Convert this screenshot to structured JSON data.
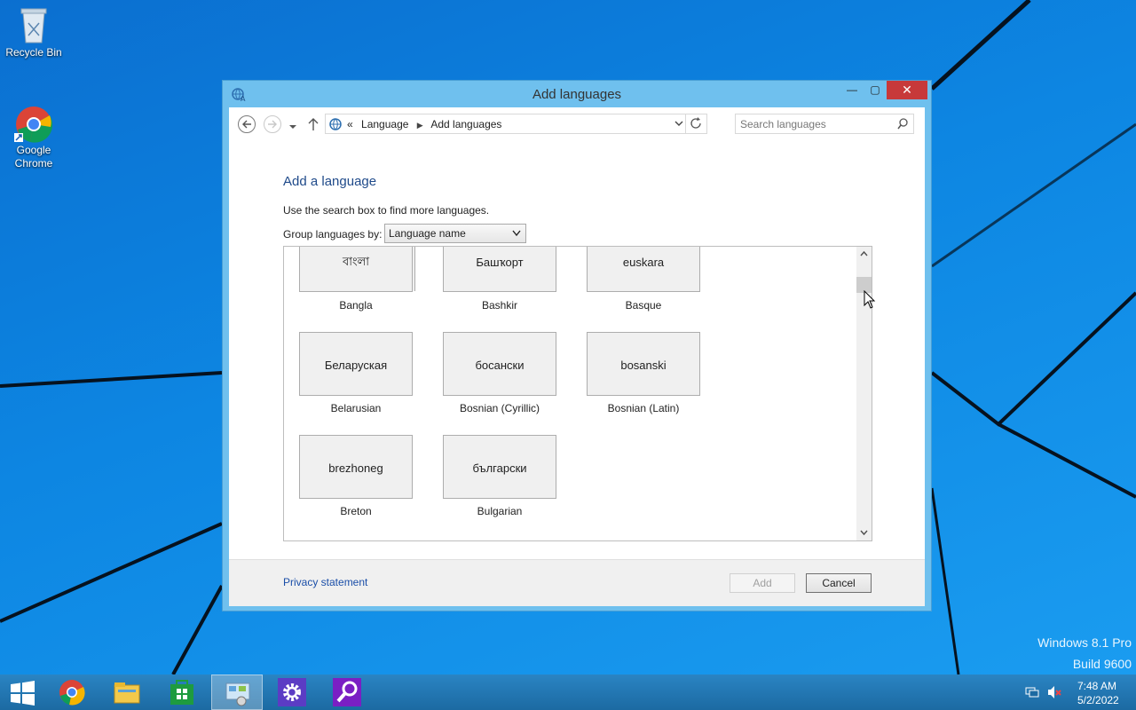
{
  "desktop": {
    "icons": [
      {
        "label": "Recycle Bin"
      },
      {
        "label": "Google Chrome"
      }
    ],
    "watermark_line1": "Windows 8.1 Pro",
    "watermark_line2": "Build 9600"
  },
  "window": {
    "title": "Add languages",
    "controls": {
      "minimize": "—",
      "maximize": "▢",
      "close": "✕"
    }
  },
  "address_bar": {
    "overflow": "«",
    "breadcrumbs": [
      "Language",
      "Add languages"
    ],
    "separator": "▶"
  },
  "search": {
    "placeholder": "Search languages"
  },
  "content": {
    "heading": "Add a language",
    "hint": "Use the search box to find more languages.",
    "group_label": "Group languages by:",
    "group_value": "Language name"
  },
  "languages": [
    {
      "native": "বাংলা",
      "name": "Bangla"
    },
    {
      "native": "Башҡорт",
      "name": "Bashkir"
    },
    {
      "native": "euskara",
      "name": "Basque"
    },
    {
      "native": "Беларуская",
      "name": "Belarusian"
    },
    {
      "native": "босански",
      "name": "Bosnian (Cyrillic)"
    },
    {
      "native": "bosanski",
      "name": "Bosnian (Latin)"
    },
    {
      "native": "brezhoneg",
      "name": "Breton"
    },
    {
      "native": "български",
      "name": "Bulgarian"
    }
  ],
  "footer": {
    "privacy": "Privacy statement",
    "add": "Add",
    "cancel": "Cancel"
  },
  "tray": {
    "time": "7:48 AM",
    "date": "5/2/2022"
  },
  "colors": {
    "accent": "#1f4a8a",
    "link": "#1a4ea8",
    "close": "#c7393a",
    "window_frame": "#6fc0ee"
  }
}
